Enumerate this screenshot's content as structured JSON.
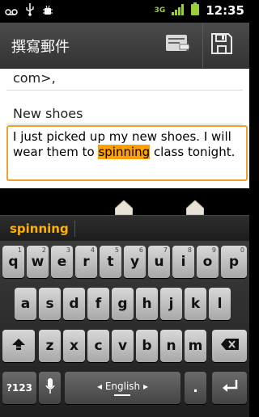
{
  "status_bar": {
    "left_icons": [
      "voicemail-icon",
      "usb-icon",
      "android-debug-icon"
    ],
    "network_type": "3G",
    "time": "12:35",
    "right_icons": [
      "3g-icon",
      "signal-icon",
      "battery-icon"
    ]
  },
  "action_bar": {
    "title": "撰寫郵件",
    "actions": [
      {
        "name": "send",
        "icon": "send-icon"
      },
      {
        "name": "save-draft",
        "icon": "save-icon"
      }
    ]
  },
  "compose": {
    "to_field_value": "com>,",
    "subject_value": "New shoes",
    "body_before": "I just picked up my new shoes. I will wear them to ",
    "body_highlight": "spinning",
    "body_after": " class tonight."
  },
  "suggestions": {
    "word": "spinning"
  },
  "colors": {
    "accent_orange": "#ffa000",
    "suggestion_text": "#ffb000",
    "status_green": "#9ccd3b"
  },
  "keyboard": {
    "row1": [
      {
        "label": "q",
        "hint": "1"
      },
      {
        "label": "w",
        "hint": "2"
      },
      {
        "label": "e",
        "hint": "3"
      },
      {
        "label": "r",
        "hint": "4"
      },
      {
        "label": "t",
        "hint": "5"
      },
      {
        "label": "y",
        "hint": "6"
      },
      {
        "label": "u",
        "hint": "7"
      },
      {
        "label": "i",
        "hint": "8"
      },
      {
        "label": "o",
        "hint": "9"
      },
      {
        "label": "p",
        "hint": "0"
      }
    ],
    "row2": [
      "a",
      "s",
      "d",
      "f",
      "g",
      "h",
      "j",
      "k",
      "l"
    ],
    "row3": [
      "z",
      "x",
      "c",
      "v",
      "b",
      "n",
      "m"
    ],
    "shift_icon": "shift-icon",
    "backspace_icon": "backspace-icon",
    "numbers_label": "?123",
    "mic_icon": "microphone-icon",
    "space_label": "◂ English ▸",
    "period_label": ".",
    "enter_icon": "enter-icon"
  }
}
